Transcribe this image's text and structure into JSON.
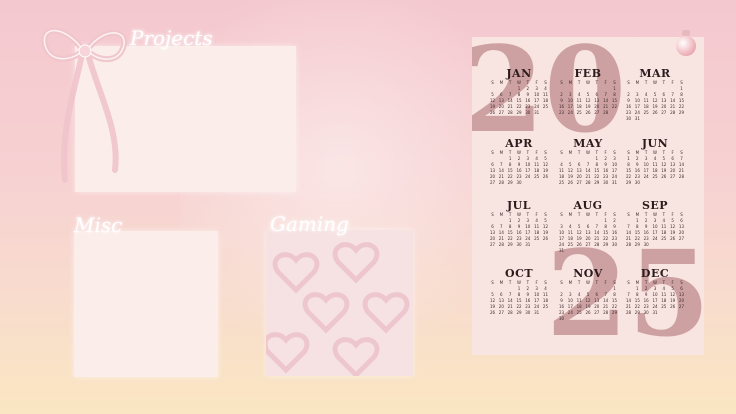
{
  "zones": {
    "projects_label": "Projects",
    "misc_label": "Misc",
    "gaming_label": "Gaming"
  },
  "calendar": {
    "year_top": "20",
    "year_bottom": "25",
    "dow": [
      "S",
      "M",
      "T",
      "W",
      "T",
      "F",
      "S"
    ],
    "months": [
      {
        "name": "JAN",
        "start": 3,
        "days": 31
      },
      {
        "name": "FEB",
        "start": 6,
        "days": 28
      },
      {
        "name": "MAR",
        "start": 6,
        "days": 31
      },
      {
        "name": "APR",
        "start": 2,
        "days": 30
      },
      {
        "name": "MAY",
        "start": 4,
        "days": 31
      },
      {
        "name": "JUN",
        "start": 0,
        "days": 30
      },
      {
        "name": "JUL",
        "start": 2,
        "days": 31
      },
      {
        "name": "AUG",
        "start": 5,
        "days": 31
      },
      {
        "name": "SEP",
        "start": 1,
        "days": 30
      },
      {
        "name": "OCT",
        "start": 3,
        "days": 31
      },
      {
        "name": "NOV",
        "start": 6,
        "days": 30
      },
      {
        "name": "DEC",
        "start": 1,
        "days": 31
      }
    ]
  },
  "colors": {
    "calendar_bg": "#f8e4e0",
    "year_digits": "#c99a9c",
    "box_bg": "#fbeeea"
  }
}
